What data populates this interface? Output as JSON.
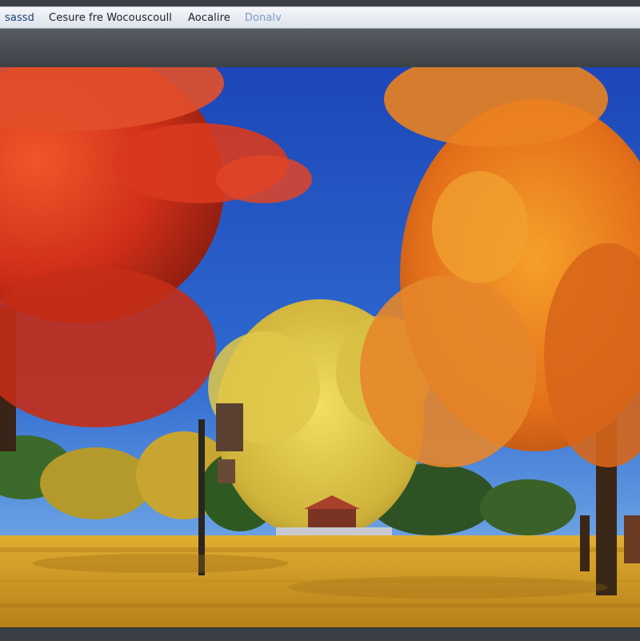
{
  "menubar": {
    "items": [
      "sassd",
      "Cesure fre Wocouscoull",
      "Aocalire",
      "Donalv"
    ]
  },
  "photo": {
    "subject": "autumn park scene",
    "colors": {
      "sky_top": "#1d46b8",
      "sky_bottom": "#7fb6ec",
      "left_tree": "#d2361c",
      "right_tree": "#e8761c",
      "center_tree": "#d6b93a",
      "ground": "#d8a22a"
    }
  }
}
